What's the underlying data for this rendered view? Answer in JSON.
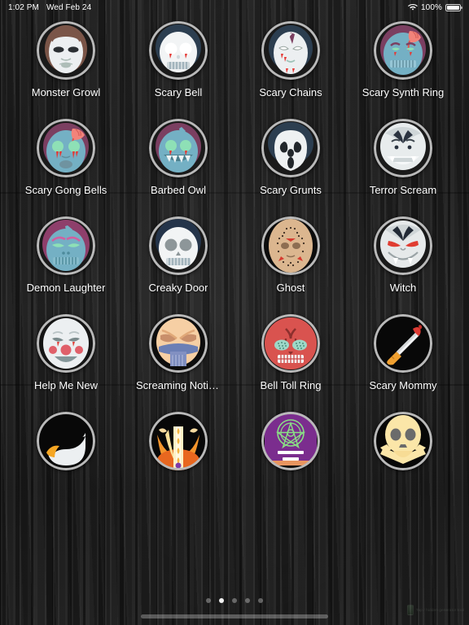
{
  "status_bar": {
    "time": "1:02 PM",
    "date": "Wed Feb 24",
    "wifi_icon": "wifi-icon",
    "battery_percent": "100%",
    "battery_icon": "battery-full-icon"
  },
  "home_screen": {
    "page_dots": {
      "total": 5,
      "active_index": 1
    },
    "home_indicator": "home-indicator-bar",
    "watermark": {
      "text": "Tap / hidden generator tool"
    },
    "apps": [
      {
        "label": "Monster Growl",
        "icon": "michael-myers-mask-icon",
        "row": 1,
        "col": 1
      },
      {
        "label": "Scary Bell",
        "icon": "bleeding-skull-icon",
        "row": 1,
        "col": 2
      },
      {
        "label": "Scary Chains",
        "icon": "pale-vampire-face-icon",
        "row": 1,
        "col": 3
      },
      {
        "label": "Scary Synth Ring",
        "icon": "blue-zombie-brain-icon",
        "row": 1,
        "col": 4
      },
      {
        "label": "Scary Gong Bells",
        "icon": "crying-zombie-brain-icon",
        "row": 2,
        "col": 1
      },
      {
        "label": "Barbed Owl",
        "icon": "fanged-zombie-icon",
        "row": 2,
        "col": 2
      },
      {
        "label": "Scary Grunts",
        "icon": "ghostface-mask-icon",
        "row": 2,
        "col": 3
      },
      {
        "label": "Terror Scream",
        "icon": "grinning-vampire-icon",
        "row": 2,
        "col": 4
      },
      {
        "label": "Demon Laughter",
        "icon": "stitched-zombie-icon",
        "row": 3,
        "col": 1
      },
      {
        "label": "Creaky Door",
        "icon": "grey-eyed-skull-icon",
        "row": 3,
        "col": 2
      },
      {
        "label": "Ghost",
        "icon": "jason-hockey-mask-icon",
        "row": 3,
        "col": 3
      },
      {
        "label": "Witch",
        "icon": "red-eyed-demon-icon",
        "row": 3,
        "col": 4
      },
      {
        "label": "Help Me New",
        "icon": "creepy-doll-face-icon",
        "row": 4,
        "col": 1
      },
      {
        "label": "Screaming Notific...",
        "icon": "gas-mask-face-icon",
        "row": 4,
        "col": 2
      },
      {
        "label": "Bell Toll Ring",
        "icon": "red-sugar-skull-icon",
        "row": 4,
        "col": 3
      },
      {
        "label": "Scary Mommy",
        "icon": "bloody-knife-icon",
        "row": 4,
        "col": 4
      },
      {
        "label": "",
        "icon": "black-white-swirl-icon",
        "row": 5,
        "col": 1
      },
      {
        "label": "",
        "icon": "orange-candle-icon",
        "row": 5,
        "col": 2
      },
      {
        "label": "",
        "icon": "purple-pentagram-icon",
        "row": 5,
        "col": 3
      },
      {
        "label": "",
        "icon": "skull-crossbones-icon",
        "row": 5,
        "col": 4
      }
    ]
  },
  "colors": {
    "ring": "#b9b9b9",
    "label_text": "#ffffff",
    "wallpaper": "#262626",
    "active_dot": "#f2f2f2"
  }
}
